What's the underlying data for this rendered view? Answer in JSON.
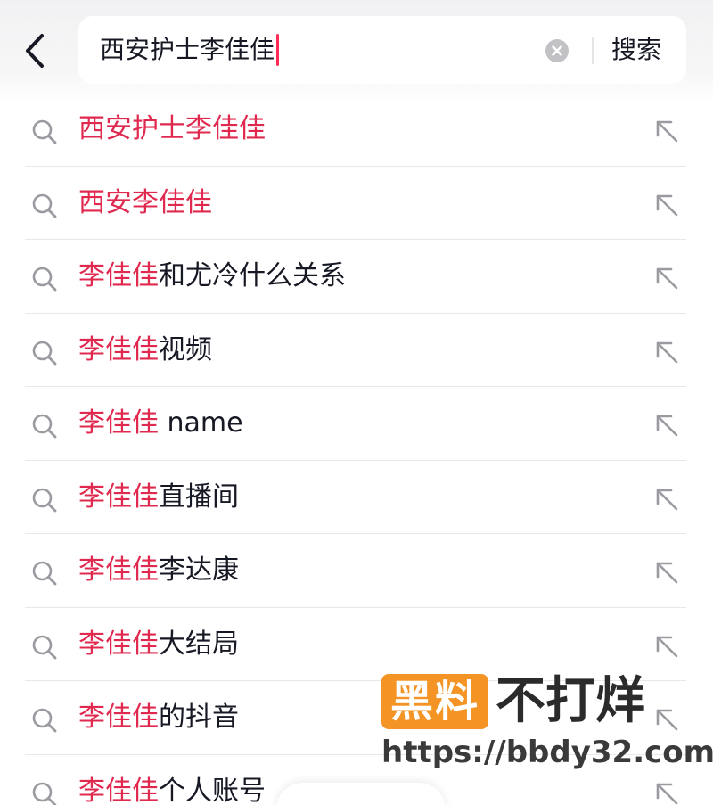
{
  "search": {
    "query": "西安护士李佳佳",
    "submit_label": "搜索"
  },
  "suggestions": [
    {
      "highlight": "西安护士李佳佳",
      "rest": ""
    },
    {
      "highlight": "西安李佳佳",
      "rest": ""
    },
    {
      "highlight": "李佳佳",
      "rest": "和尤冷什么关系"
    },
    {
      "highlight": "李佳佳",
      "rest": "视频"
    },
    {
      "highlight": "李佳佳",
      "rest": " name"
    },
    {
      "highlight": "李佳佳",
      "rest": "直播间"
    },
    {
      "highlight": "李佳佳",
      "rest": "李达康"
    },
    {
      "highlight": "李佳佳",
      "rest": "大结局"
    },
    {
      "highlight": "李佳佳",
      "rest": "的抖音"
    },
    {
      "highlight": "李佳佳",
      "rest": "个人账号"
    }
  ],
  "watermark": {
    "badge": "黑料",
    "tagline": "不打烊",
    "url": "https://bbdy32.com"
  },
  "colors": {
    "accent": "#e0294f",
    "text": "#161823",
    "icon": "#9a9aa0"
  }
}
